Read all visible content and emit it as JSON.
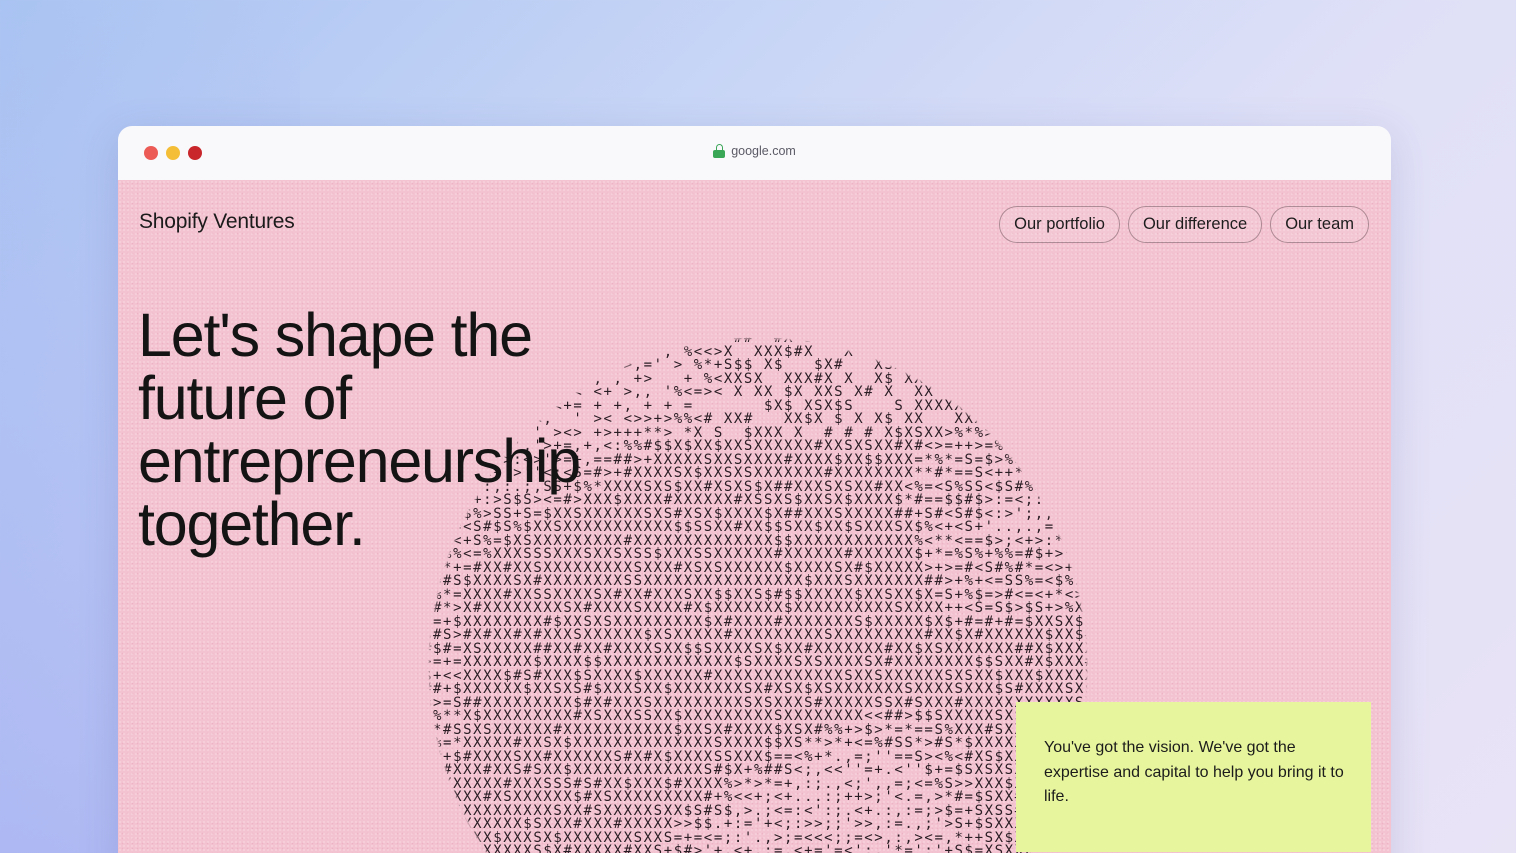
{
  "browser": {
    "url": "google.com",
    "traffic_colors": [
      "#ec5b56",
      "#f4be36",
      "#c8262b"
    ]
  },
  "page": {
    "brand": "Shopify Ventures",
    "nav": [
      {
        "label": "Our portfolio"
      },
      {
        "label": "Our difference"
      },
      {
        "label": "Our team"
      }
    ],
    "headline_lines": [
      "Let's shape the",
      "future of",
      "entrepreneurship",
      "together."
    ],
    "callout": "You've got the vision. We've got the expertise and capital to help you bring it to life.",
    "colors": {
      "background": "#f4c3d1",
      "callout_background": "#e7f59c",
      "ascii_ink": "#2a1d24"
    },
    "globe_icon": "ascii-globe"
  }
}
